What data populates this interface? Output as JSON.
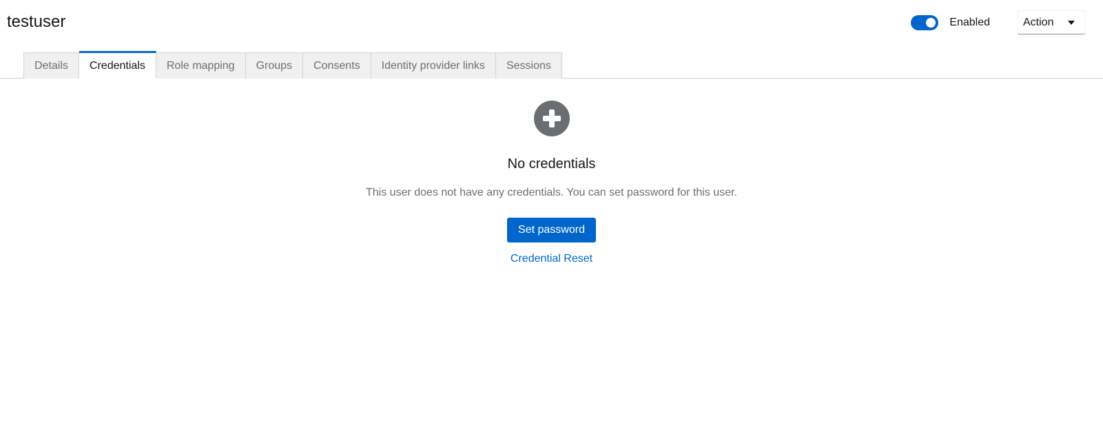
{
  "header": {
    "title": "testuser",
    "enabled_label": "Enabled",
    "enabled": true,
    "action_label": "Action"
  },
  "tabs": [
    {
      "label": "Details",
      "active": false
    },
    {
      "label": "Credentials",
      "active": true
    },
    {
      "label": "Role mapping",
      "active": false
    },
    {
      "label": "Groups",
      "active": false
    },
    {
      "label": "Consents",
      "active": false
    },
    {
      "label": "Identity provider links",
      "active": false
    },
    {
      "label": "Sessions",
      "active": false
    }
  ],
  "empty_state": {
    "icon": "plus-circle-icon",
    "title": "No credentials",
    "body": "This user does not have any credentials. You can set password for this user.",
    "primary_button": "Set password",
    "secondary_link": "Credential Reset"
  },
  "colors": {
    "accent": "#0066cc",
    "icon_gray": "#6a6e73",
    "tab_bg": "#f0f0f0"
  }
}
